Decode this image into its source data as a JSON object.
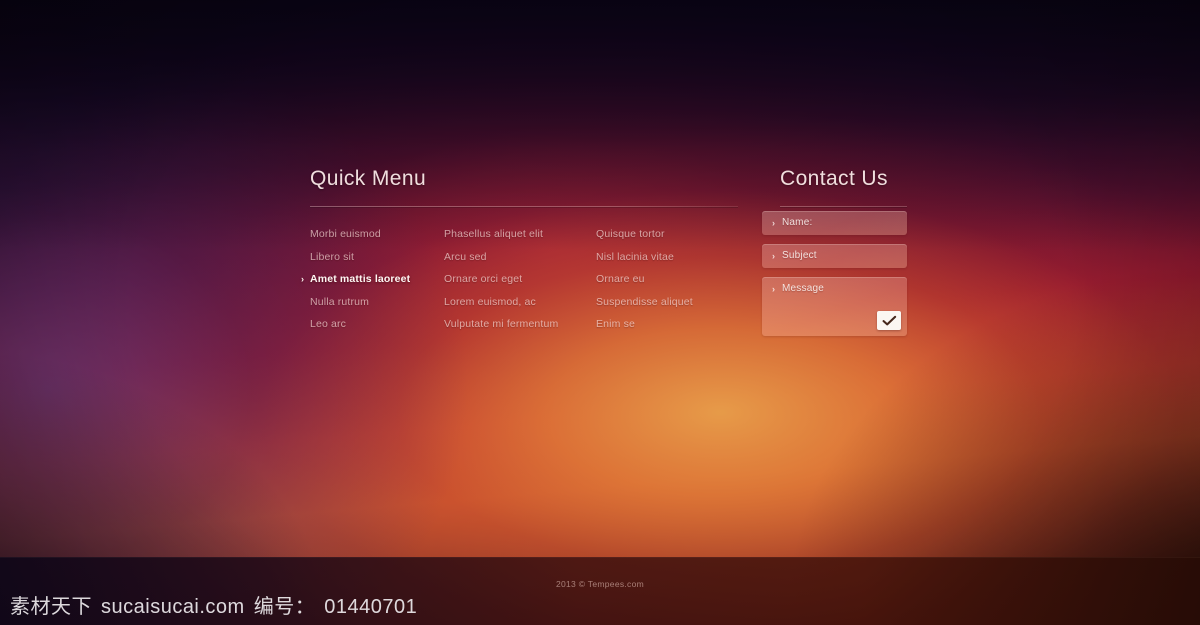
{
  "background": {
    "top_left_color": "#0d0419",
    "top_right_color": "#1d0a1e",
    "center_glow_color": "#e09a4a",
    "left_violet_color": "#5a3c80",
    "bottom_right_color": "#2a0d06",
    "crimson_color": "#a7182f"
  },
  "quick_menu": {
    "title": "Quick Menu",
    "columns": [
      {
        "items": [
          {
            "label": "Morbi euismod",
            "active": false
          },
          {
            "label": "Libero sit",
            "active": false
          },
          {
            "label": "Amet mattis laoreet",
            "active": true
          },
          {
            "label": "Nulla rutrum",
            "active": false
          },
          {
            "label": "Leo arc",
            "active": false
          }
        ]
      },
      {
        "items": [
          {
            "label": "Phasellus aliquet elit",
            "active": false
          },
          {
            "label": "Arcu sed",
            "active": false
          },
          {
            "label": "Ornare orci eget",
            "active": false
          },
          {
            "label": "Lorem euismod, ac",
            "active": false
          },
          {
            "label": "Vulputate mi fermentum",
            "active": false
          }
        ]
      },
      {
        "items": [
          {
            "label": "Quisque tortor",
            "active": false
          },
          {
            "label": "Nisl lacinia vitae",
            "active": false
          },
          {
            "label": "Ornare eu",
            "active": false
          },
          {
            "label": "Suspendisse aliquet",
            "active": false
          },
          {
            "label": "Enim se",
            "active": false
          }
        ]
      }
    ]
  },
  "contact": {
    "title": "Contact Us",
    "chevron": "›",
    "fields": {
      "name": {
        "label": "Name:",
        "value": "",
        "placeholder": "Name:"
      },
      "subject": {
        "label": "Subject",
        "value": "",
        "placeholder": "Subject"
      },
      "message": {
        "label": "Message",
        "value": "",
        "placeholder": "Message"
      }
    },
    "submit": {
      "icon": "checkmark-icon",
      "label": ""
    }
  },
  "footer": {
    "copyright": "2013 © Tempees.com"
  },
  "watermark": {
    "brand": "素材天下",
    "site": "sucaisucai.com",
    "code_label": "编号：",
    "code": "01440701"
  }
}
